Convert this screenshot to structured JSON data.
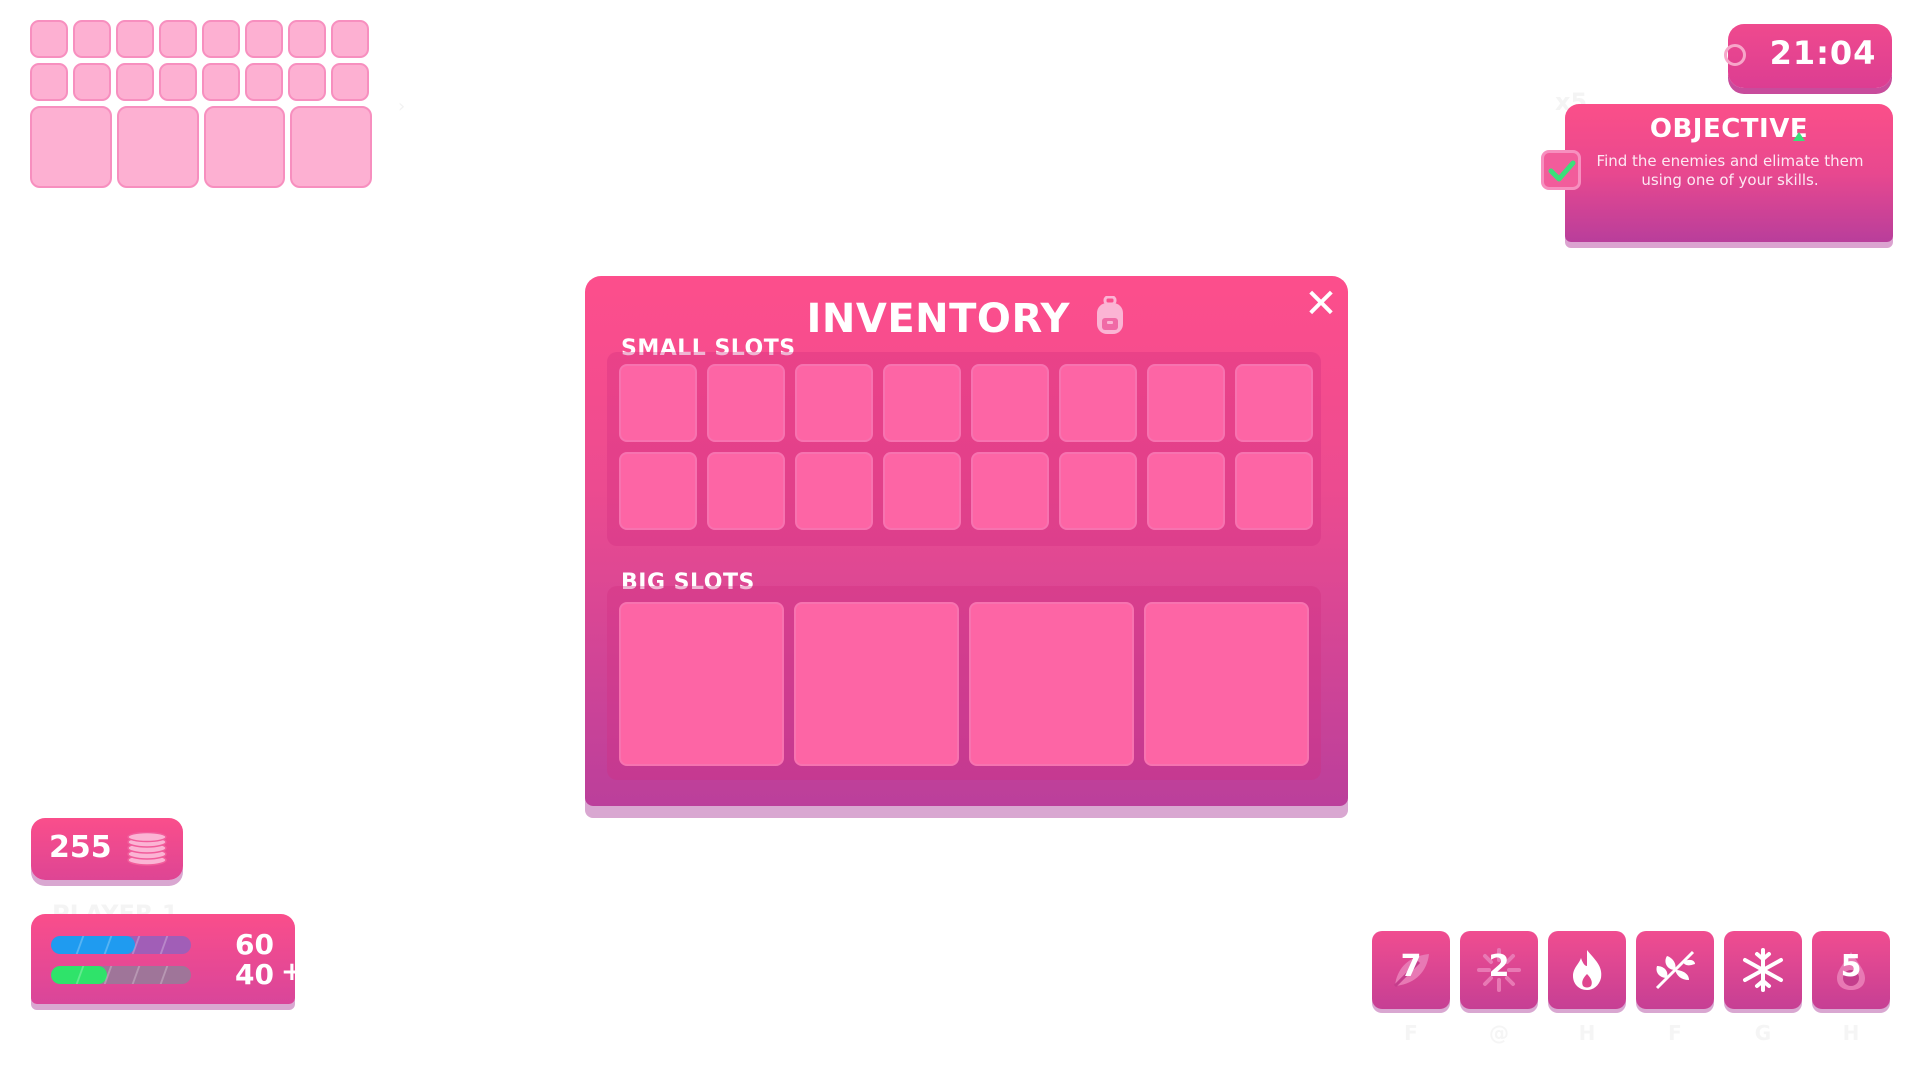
{
  "mini_inventory": {
    "small_rows": 2,
    "small_cols": 8,
    "big_slots": 4,
    "arrow": "›"
  },
  "timer": {
    "time": "21:04",
    "icon": "stopwatch-icon"
  },
  "objective": {
    "multiplier": "x5",
    "title": "OBJECTIVE",
    "description": "Find the enemies and elimate them using one of your skills.",
    "completed": true
  },
  "inventory": {
    "title": "INVENTORY",
    "title_icon": "backpack-icon",
    "close_label": "✕",
    "small_slots_label": "SMALL SLOTS",
    "big_slots_label": "BIG SLOTS",
    "small_rows": 2,
    "small_cols": 8,
    "big_count": 4
  },
  "coins": {
    "amount": "255",
    "icon": "coin-stack-icon"
  },
  "player": {
    "name": "PLAYER 1",
    "mana": {
      "value": "60",
      "fraction": 0.6,
      "color": "#1f9bf0"
    },
    "health": {
      "value": "40",
      "fraction": 0.4,
      "color": "#2fe36a"
    },
    "health_extra": "+"
  },
  "skills": [
    {
      "icon": "leaf-icon",
      "count": "7",
      "key": "F"
    },
    {
      "icon": "sparkle-burst-icon",
      "count": "2",
      "key": "@"
    },
    {
      "icon": "fire-icon",
      "count": "",
      "key": "H"
    },
    {
      "icon": "leaves-icon",
      "count": "",
      "key": "F"
    },
    {
      "icon": "snowflake-icon",
      "count": "",
      "key": "G"
    },
    {
      "icon": "blood-drop-icon",
      "count": "5",
      "key": "H"
    }
  ],
  "colors": {
    "accent": "#fd4e8c",
    "slot": "#fd65a5",
    "mini_slot": "#fdb0d2"
  }
}
